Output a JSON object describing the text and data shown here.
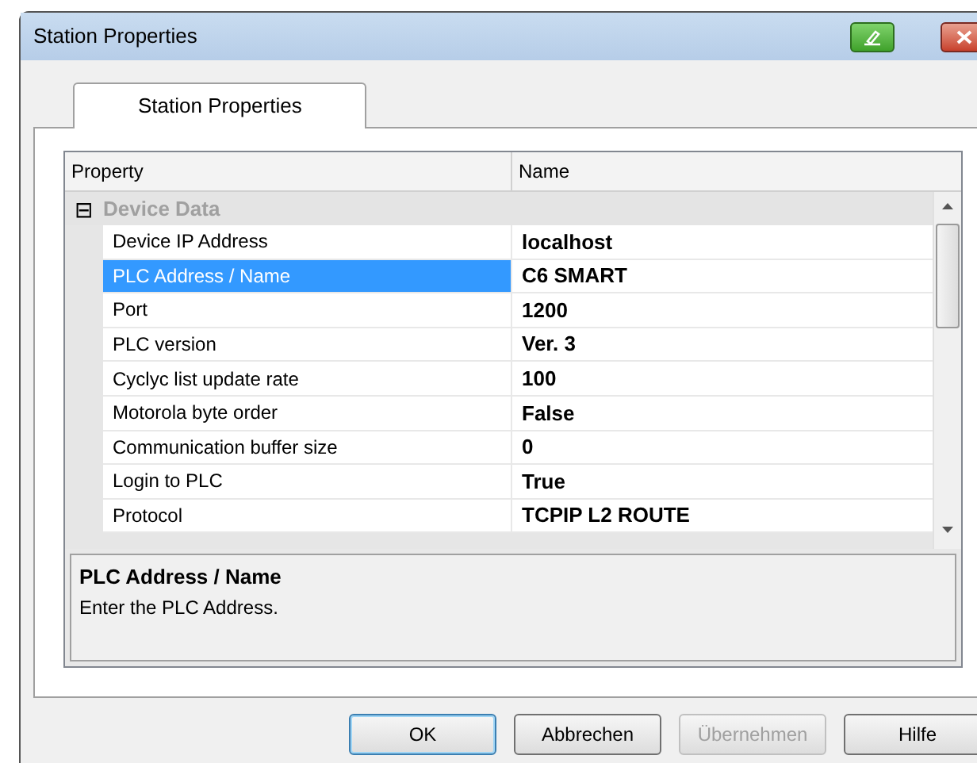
{
  "window": {
    "title": "Station Properties"
  },
  "tabs": [
    {
      "label": "Station Properties",
      "selected": true
    }
  ],
  "grid": {
    "columns": [
      "Property",
      "Name"
    ],
    "groups": [
      {
        "label": "Device Data",
        "expanded": true,
        "toggle": "⊟",
        "rows": [
          {
            "property": "Device IP Address",
            "value": "localhost",
            "selected": false
          },
          {
            "property": "PLC Address / Name",
            "value": "C6 SMART",
            "selected": true
          },
          {
            "property": "Port",
            "value": "1200",
            "selected": false
          },
          {
            "property": "PLC version",
            "value": "Ver. 3",
            "selected": false
          },
          {
            "property": "Cyclyc list update rate",
            "value": "100",
            "selected": false
          },
          {
            "property": "Motorola byte order",
            "value": "False",
            "selected": false
          },
          {
            "property": "Communication buffer size",
            "value": "0",
            "selected": false
          },
          {
            "property": "Login to PLC",
            "value": "True",
            "selected": false
          },
          {
            "property": "Protocol",
            "value": "TCPIP L2 ROUTE",
            "selected": false
          }
        ]
      }
    ]
  },
  "description": {
    "title": "PLC Address / Name",
    "text": "Enter the PLC Address."
  },
  "buttons": [
    {
      "label": "OK",
      "default": true,
      "disabled": false
    },
    {
      "label": "Abbrechen",
      "default": false,
      "disabled": false
    },
    {
      "label": "Übernehmen",
      "default": false,
      "disabled": true
    },
    {
      "label": "Hilfe",
      "default": false,
      "disabled": false
    }
  ]
}
